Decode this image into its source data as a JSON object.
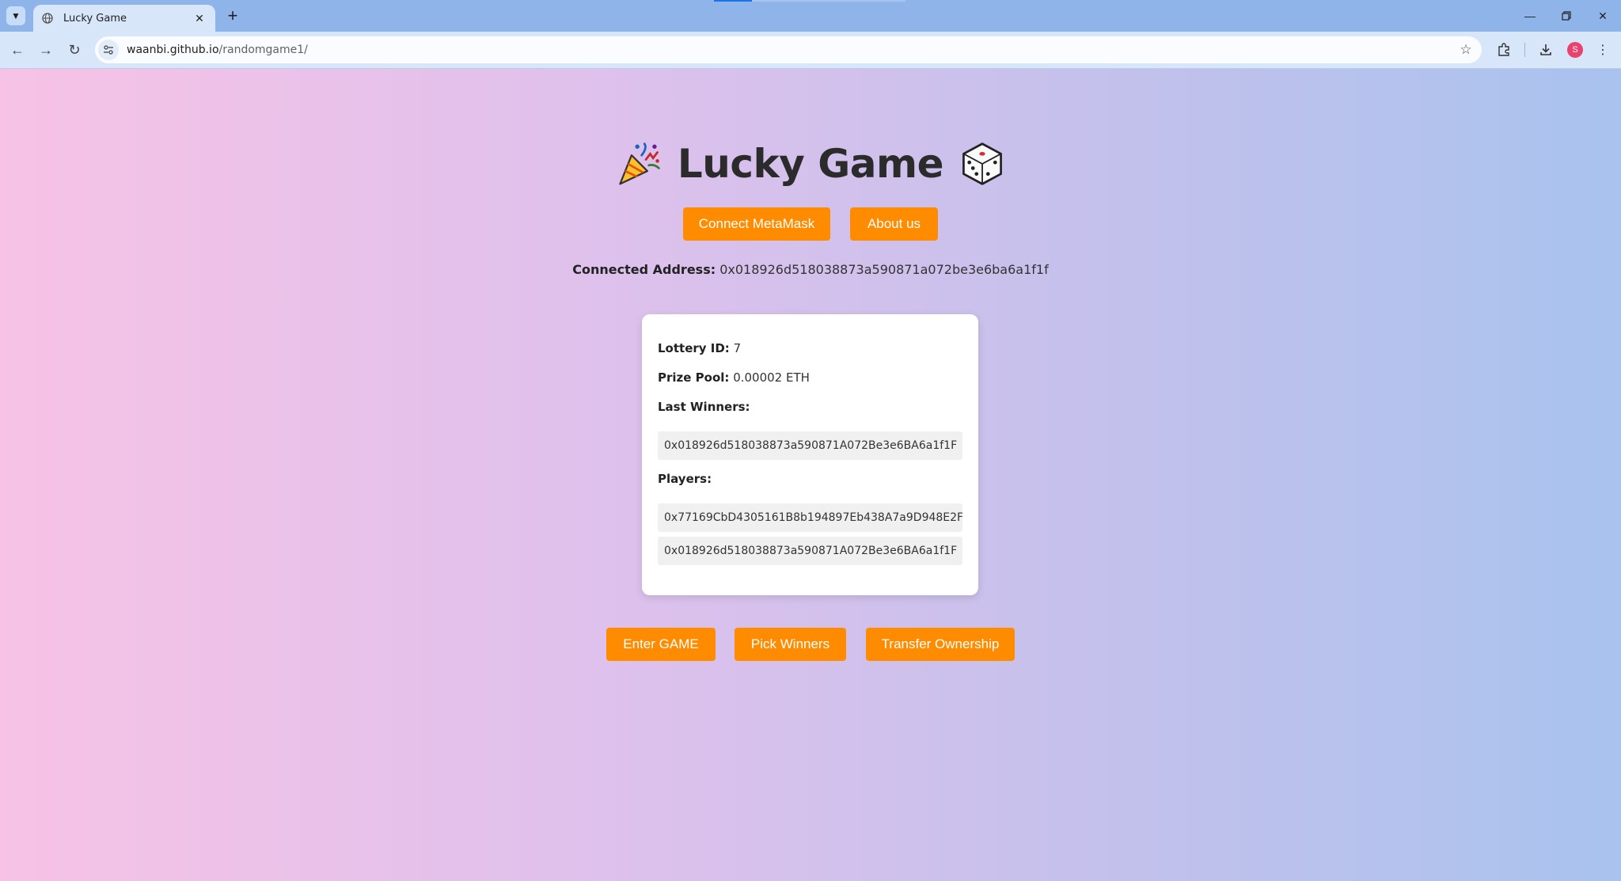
{
  "browser": {
    "tab_title": "Lucky Game",
    "url_host": "waanbi.github.io",
    "url_path": "/randomgame1/",
    "profile_initial": "S"
  },
  "page": {
    "title": "Lucky Game",
    "title_emoji_left": "party-popper",
    "title_emoji_right": "dice",
    "buttons": {
      "connect": "Connect MetaMask",
      "about": "About us",
      "enter": "Enter GAME",
      "pick": "Pick Winners",
      "transfer": "Transfer Ownership"
    },
    "connected_label": "Connected Address:",
    "connected_address": "0x018926d518038873a590871a072be3e6ba6a1f1f",
    "lottery": {
      "id_label": "Lottery ID:",
      "id_value": "7",
      "prize_label": "Prize Pool:",
      "prize_value": "0.00002 ETH",
      "winners_label": "Last Winners:",
      "winners": [
        "0x018926d518038873a590871A072Be3e6BA6a1f1F"
      ],
      "players_label": "Players:",
      "players": [
        "0x77169CbD4305161B8b194897Eb438A7a9D948E2F",
        "0x018926d518038873a590871A072Be3e6BA6a1f1F"
      ]
    },
    "colors": {
      "button": "#ff8c00",
      "card": "#ffffff"
    }
  }
}
